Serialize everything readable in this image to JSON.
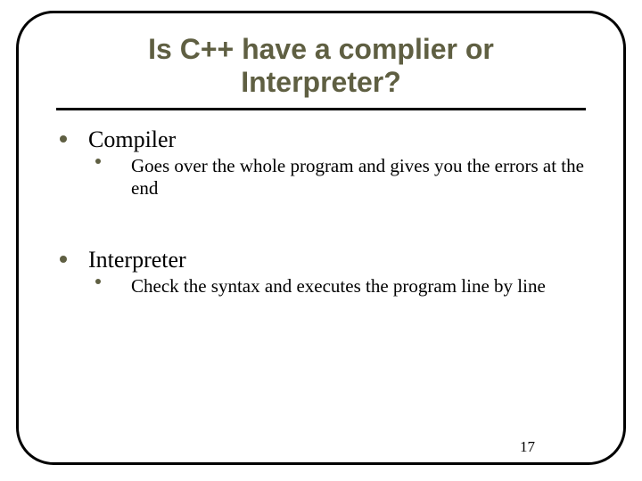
{
  "title_line1": "Is C++ have a complier or",
  "title_line2": "Interpreter?",
  "items": [
    {
      "heading": "Compiler",
      "sub": "Goes over the whole program and gives you the errors  at the end"
    },
    {
      "heading": "Interpreter",
      "sub": "Check the syntax and executes the program line by line"
    }
  ],
  "page_number": "17"
}
